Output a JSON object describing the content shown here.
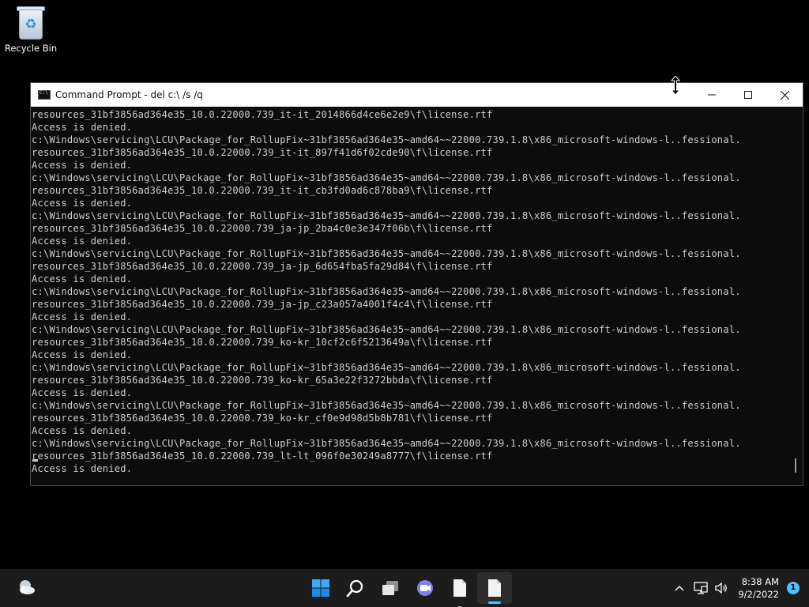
{
  "desktop": {
    "icons": [
      {
        "label": "Recycle Bin",
        "icon": "recycle-bin-icon"
      }
    ]
  },
  "window": {
    "title": "Command Prompt - del  c:\\ /s /q",
    "icon": "cmd-icon",
    "controls": [
      "minimize-icon",
      "maximize-icon",
      "close-icon"
    ]
  },
  "console": {
    "lines": [
      "resources_31bf3856ad364e35_10.0.22000.739_it-it_2014866d4ce6e2e9\\f\\license.rtf",
      "Access is denied.",
      "c:\\Windows\\servicing\\LCU\\Package_for_RollupFix~31bf3856ad364e35~amd64~~22000.739.1.8\\x86_microsoft-windows-l..fessional.",
      "resources_31bf3856ad364e35_10.0.22000.739_it-it_897f41d6f02cde90\\f\\license.rtf",
      "Access is denied.",
      "c:\\Windows\\servicing\\LCU\\Package_for_RollupFix~31bf3856ad364e35~amd64~~22000.739.1.8\\x86_microsoft-windows-l..fessional.",
      "resources_31bf3856ad364e35_10.0.22000.739_it-it_cb3fd0ad6c878ba9\\f\\license.rtf",
      "Access is denied.",
      "c:\\Windows\\servicing\\LCU\\Package_for_RollupFix~31bf3856ad364e35~amd64~~22000.739.1.8\\x86_microsoft-windows-l..fessional.",
      "resources_31bf3856ad364e35_10.0.22000.739_ja-jp_2ba4c0e3e347f06b\\f\\license.rtf",
      "Access is denied.",
      "c:\\Windows\\servicing\\LCU\\Package_for_RollupFix~31bf3856ad364e35~amd64~~22000.739.1.8\\x86_microsoft-windows-l..fessional.",
      "resources_31bf3856ad364e35_10.0.22000.739_ja-jp_6d654fba5fa29d84\\f\\license.rtf",
      "Access is denied.",
      "c:\\Windows\\servicing\\LCU\\Package_for_RollupFix~31bf3856ad364e35~amd64~~22000.739.1.8\\x86_microsoft-windows-l..fessional.",
      "resources_31bf3856ad364e35_10.0.22000.739_ja-jp_c23a057a4001f4c4\\f\\license.rtf",
      "Access is denied.",
      "c:\\Windows\\servicing\\LCU\\Package_for_RollupFix~31bf3856ad364e35~amd64~~22000.739.1.8\\x86_microsoft-windows-l..fessional.",
      "resources_31bf3856ad364e35_10.0.22000.739_ko-kr_10cf2c6f5213649a\\f\\license.rtf",
      "Access is denied.",
      "c:\\Windows\\servicing\\LCU\\Package_for_RollupFix~31bf3856ad364e35~amd64~~22000.739.1.8\\x86_microsoft-windows-l..fessional.",
      "resources_31bf3856ad364e35_10.0.22000.739_ko-kr_65a3e22f3272bbda\\f\\license.rtf",
      "Access is denied.",
      "c:\\Windows\\servicing\\LCU\\Package_for_RollupFix~31bf3856ad364e35~amd64~~22000.739.1.8\\x86_microsoft-windows-l..fessional.",
      "resources_31bf3856ad364e35_10.0.22000.739_ko-kr_cf0e9d98d5b8b781\\f\\license.rtf",
      "Access is denied.",
      "c:\\Windows\\servicing\\LCU\\Package_for_RollupFix~31bf3856ad364e35~amd64~~22000.739.1.8\\x86_microsoft-windows-l..fessional.",
      "resources_31bf3856ad364e35_10.0.22000.739_lt-lt_096f0e30249a8777\\f\\license.rtf",
      "Access is denied."
    ]
  },
  "taskbar": {
    "weather_icon": "weather-icon",
    "apps": [
      {
        "name": "start-button",
        "icon": "windows-logo-icon",
        "active": false,
        "running": false
      },
      {
        "name": "search-button",
        "icon": "search-icon",
        "active": false,
        "running": false
      },
      {
        "name": "task-view-button",
        "icon": "task-view-icon",
        "active": false,
        "running": false
      },
      {
        "name": "teams-chat-button",
        "icon": "chat-icon",
        "active": false,
        "running": false
      },
      {
        "name": "file-app-button",
        "icon": "document-icon",
        "active": false,
        "running": true
      },
      {
        "name": "cmd-app-button",
        "icon": "document-icon",
        "active": true,
        "running": true
      }
    ],
    "tray": {
      "icons": [
        "chevron-up-icon",
        "network-icon",
        "volume-icon"
      ],
      "time": "8:38 AM",
      "date": "9/2/2022",
      "notification_count": "1"
    },
    "colors": {
      "accent": "#4cc2ff",
      "taskbar_bg": "#1c1c1c"
    }
  }
}
